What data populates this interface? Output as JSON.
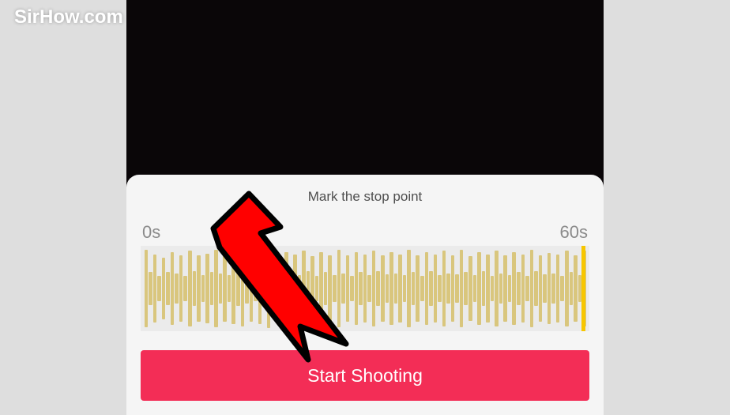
{
  "watermark": {
    "text": "SirHow.com"
  },
  "panel": {
    "title": "Mark the stop point",
    "startLabel": "0s",
    "endLabel": "60s"
  },
  "button": {
    "label": "Start Shooting"
  },
  "waveform": {
    "heights": [
      90,
      38,
      80,
      30,
      72,
      38,
      86,
      35,
      78,
      30,
      88,
      40,
      78,
      32,
      82,
      38,
      90,
      36,
      78,
      32,
      84,
      40,
      88,
      36,
      78,
      30,
      84,
      40,
      92,
      34,
      78,
      36,
      86,
      38,
      80,
      32,
      88,
      40,
      76,
      30,
      86,
      38,
      78,
      32,
      90,
      36,
      78,
      30,
      86,
      38,
      80,
      32,
      88,
      40,
      78,
      34,
      86,
      36,
      80,
      32,
      90,
      38,
      78,
      30,
      86,
      40,
      80,
      32,
      88,
      36,
      78,
      34,
      90,
      38,
      76,
      32,
      86,
      40,
      80,
      30,
      88,
      36,
      78,
      32,
      86,
      38,
      80,
      30,
      90,
      40,
      78,
      34,
      84,
      36,
      80,
      30,
      88,
      38,
      78,
      32,
      88
    ]
  }
}
